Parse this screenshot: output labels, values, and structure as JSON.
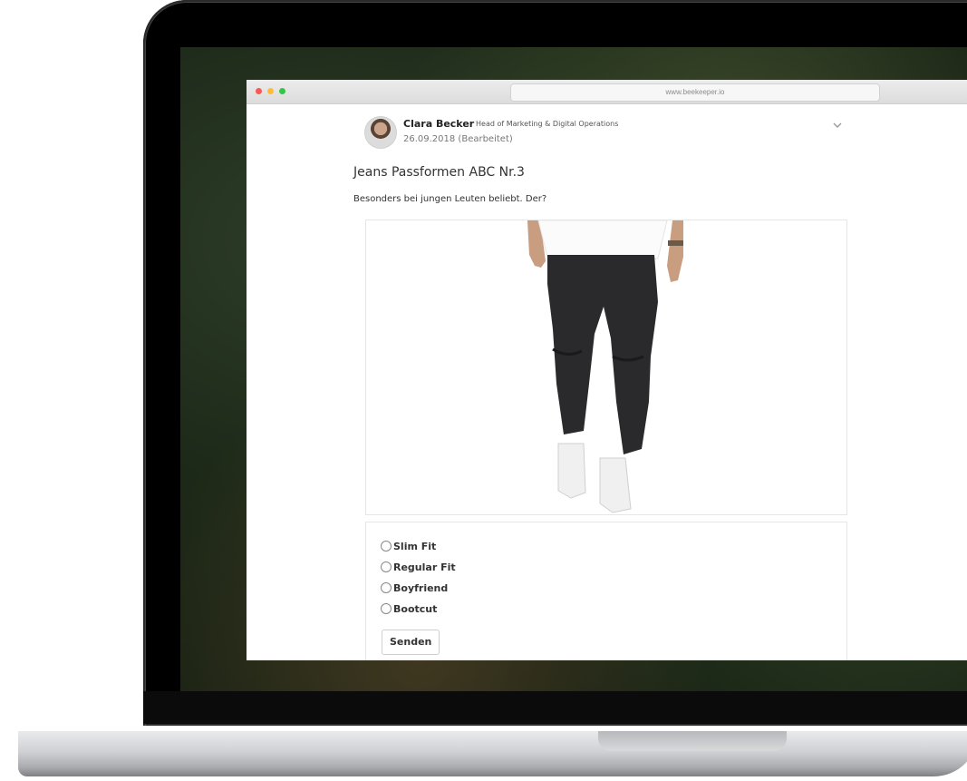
{
  "browser": {
    "url": "www.beekeeper.io"
  },
  "post": {
    "author_name": "Clara Becker",
    "author_role": "Head of Marketing & Digital Operations",
    "date": "26.09.2018 (Bearbeitet)",
    "title": "Jeans Passformen ABC Nr.3",
    "body": "Besonders bei jungen Leuten beliebt. Der?",
    "menu_icon": "chevron-down-icon"
  },
  "poll": {
    "options": [
      {
        "label": "Slim Fit"
      },
      {
        "label": "Regular Fit"
      },
      {
        "label": "Boyfriend"
      },
      {
        "label": "Bootcut"
      }
    ],
    "submit_label": "Senden"
  },
  "colors": {
    "close": "#fc5753",
    "minimize": "#fdbc40",
    "maximize": "#33c748"
  }
}
